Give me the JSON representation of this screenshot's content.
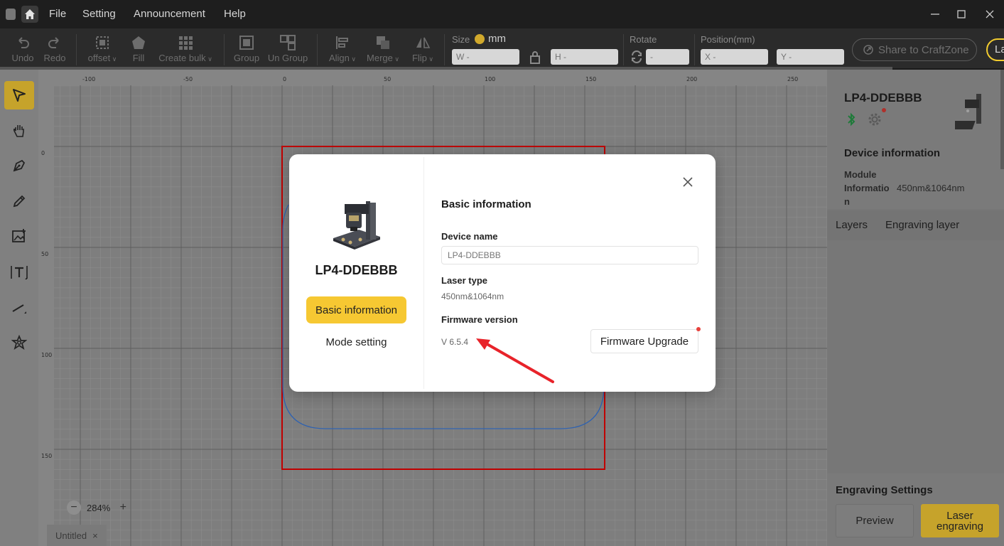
{
  "titlebar": {
    "menus": [
      "File",
      "Setting",
      "Announcement",
      "Help"
    ]
  },
  "toolbar": {
    "undo": "Undo",
    "redo": "Redo",
    "offset": "offset",
    "fill": "Fill",
    "create_bulk": "Create bulk",
    "group": "Group",
    "ungroup": "Un Group",
    "align": "Align",
    "merge": "Merge",
    "flip": "Flip",
    "size_label": "Size",
    "size_unit": "mm",
    "w_placeholder": "W -",
    "h_placeholder": "H -",
    "rotate_label": "Rotate",
    "rotate_placeholder": "-",
    "position_label": "Position(mm)",
    "x_placeholder": "X -",
    "y_placeholder": "Y -",
    "share": "Share to CraftZone",
    "laser_short": "La"
  },
  "canvas": {
    "ruler_top": [
      "-100",
      "-50",
      "0",
      "50",
      "100",
      "150",
      "200",
      "250"
    ],
    "ruler_left": [
      "0",
      "50",
      "100",
      "150"
    ],
    "zoom": "284%",
    "zoom_minus": "−",
    "zoom_plus": "+",
    "doc_tab": "Untitled",
    "doc_tab_close": "×"
  },
  "right_panel": {
    "device_name": "LP4-DDEBBB",
    "device_info_title": "Device information",
    "module_label": "Module Informatio n",
    "module_value": "450nm&1064nm",
    "tab_layers": "Layers",
    "tab_engraving_layer": "Engraving layer",
    "engraving_settings": "Engraving Settings",
    "preview": "Preview",
    "laser_engraving": "Laser engraving"
  },
  "modal": {
    "device_title": "LP4-DDEBBB",
    "nav_basic": "Basic information",
    "nav_mode": "Mode setting",
    "section_title": "Basic information",
    "device_name_label": "Device name",
    "device_name_value": "LP4-DDEBBB",
    "laser_type_label": "Laser type",
    "laser_type_value": "450nm&1064nm",
    "firmware_label": "Firmware version",
    "firmware_value": "V 6.5.4",
    "firmware_upgrade": "Firmware Upgrade"
  },
  "colors": {
    "accent": "#f6c832",
    "alert": "#e8413c",
    "arrow": "#e8232a",
    "shape_red": "#c00000",
    "shape_blue": "#2f62b0"
  }
}
